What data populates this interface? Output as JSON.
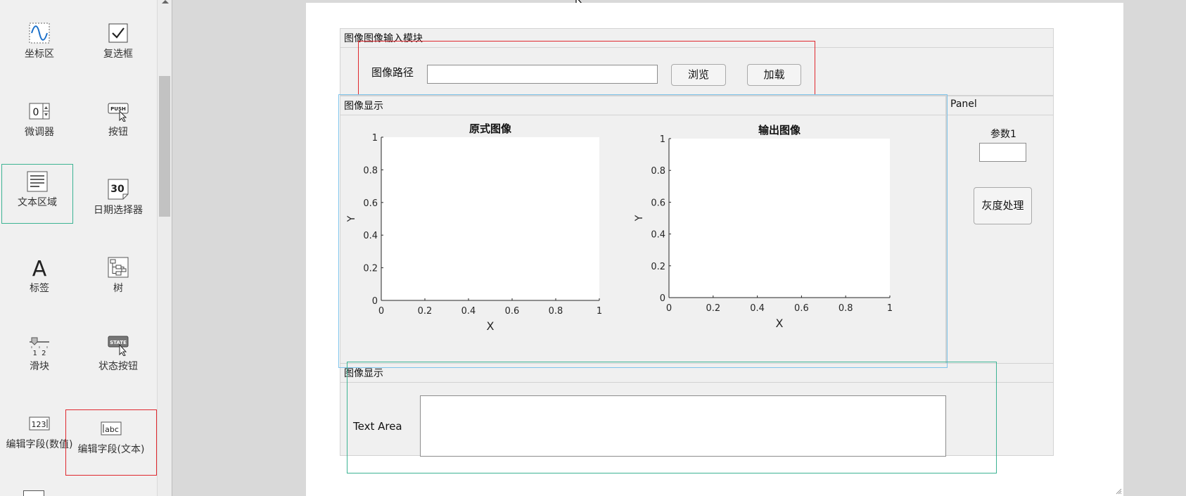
{
  "palette": {
    "items": [
      {
        "label": "坐标区",
        "icon": "sine-wave-icon"
      },
      {
        "label": "复选框",
        "icon": "checkbox-icon"
      },
      {
        "label": "微调器",
        "icon": "spinner-icon",
        "icon_text": "0"
      },
      {
        "label": "按钮",
        "icon": "push-button-icon",
        "icon_text": "PUSH"
      },
      {
        "label": "文本区域",
        "icon": "text-area-icon"
      },
      {
        "label": "日期选择器",
        "icon": "calendar-icon",
        "icon_text": "30"
      },
      {
        "label": "标签",
        "icon": "label-icon",
        "icon_text": "A"
      },
      {
        "label": "树",
        "icon": "tree-icon"
      },
      {
        "label": "滑块",
        "icon": "slider-icon",
        "icon_text": "1  2"
      },
      {
        "label": "状态按钮",
        "icon": "state-button-icon",
        "icon_text": "STATE"
      },
      {
        "label": "编辑字段(数值)",
        "icon": "numeric-field-icon",
        "icon_text": "123"
      },
      {
        "label": "编辑字段(文本)",
        "icon": "text-field-icon",
        "icon_text": "abc"
      }
    ]
  },
  "input_panel": {
    "title": "图像图像输入模块",
    "path_label": "图像路径",
    "path_value": "",
    "browse_label": "浏览",
    "load_label": "加载"
  },
  "display_panel": {
    "title": "图像显示"
  },
  "side_panel": {
    "title": "Panel",
    "param_label": "参数1",
    "param_value": "",
    "gray_button_label": "灰度处理"
  },
  "text_panel": {
    "title": "图像显示",
    "textarea_label": "Text Area",
    "textarea_value": ""
  },
  "chart_data": [
    {
      "type": "scatter",
      "title": "原式图像",
      "xlabel": "X",
      "ylabel": "Y",
      "xlim": [
        0,
        1
      ],
      "ylim": [
        0,
        1
      ],
      "xticks": [
        "0",
        "0.2",
        "0.4",
        "0.6",
        "0.8",
        "1"
      ],
      "yticks": [
        "0",
        "0.2",
        "0.4",
        "0.6",
        "0.8",
        "1"
      ],
      "series": []
    },
    {
      "type": "scatter",
      "title": "输出图像",
      "xlabel": "X",
      "ylabel": "Y",
      "xlim": [
        0,
        1
      ],
      "ylim": [
        0,
        1
      ],
      "xticks": [
        "0",
        "0.2",
        "0.4",
        "0.6",
        "0.8",
        "1"
      ],
      "yticks": [
        "0",
        "0.2",
        "0.4",
        "0.6",
        "0.8",
        "1"
      ],
      "series": []
    }
  ],
  "colors": {
    "selection_red": "#e0282e",
    "selection_green": "#3cb393",
    "selection_blue": "#7ec3ea"
  }
}
